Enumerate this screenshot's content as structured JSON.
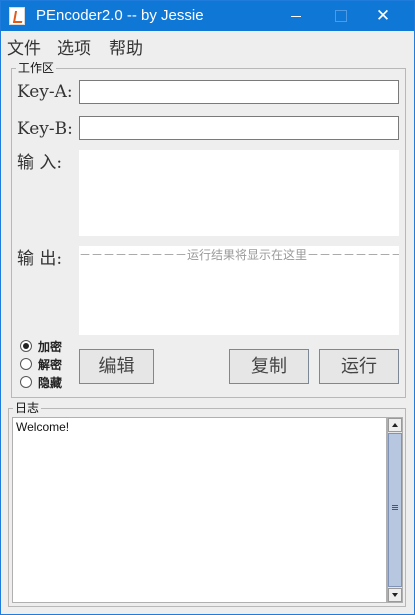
{
  "window": {
    "title": "PEncoder2.0 -- by Jessie",
    "controls": {
      "minimize": "minimize",
      "maximize": "maximize",
      "close": "✕"
    },
    "icon": "java-cup-icon"
  },
  "menu": {
    "items": [
      "文件",
      "选项",
      "帮助"
    ]
  },
  "workarea": {
    "title": "工作区",
    "key_a_label": "Key-A:",
    "key_a_value": "",
    "key_b_label": "Key-B:",
    "key_b_value": "",
    "input_label": "输 入:",
    "input_value": "",
    "output_label": "输 出:",
    "output_placeholder": "－－－－－－－－－运行结果将显示在这里－－－－－－－－－",
    "modes": [
      {
        "label": "加密",
        "selected": true
      },
      {
        "label": "解密",
        "selected": false
      },
      {
        "label": "隐藏",
        "selected": false
      }
    ],
    "buttons": {
      "edit": "编辑",
      "copy": "复制",
      "run": "运行"
    }
  },
  "log": {
    "title": "日志",
    "text": "Welcome!"
  },
  "colors": {
    "titlebar": "#0f78d7",
    "window_bg": "#eeeeee",
    "scroll_thumb": "#b8c7e0"
  }
}
